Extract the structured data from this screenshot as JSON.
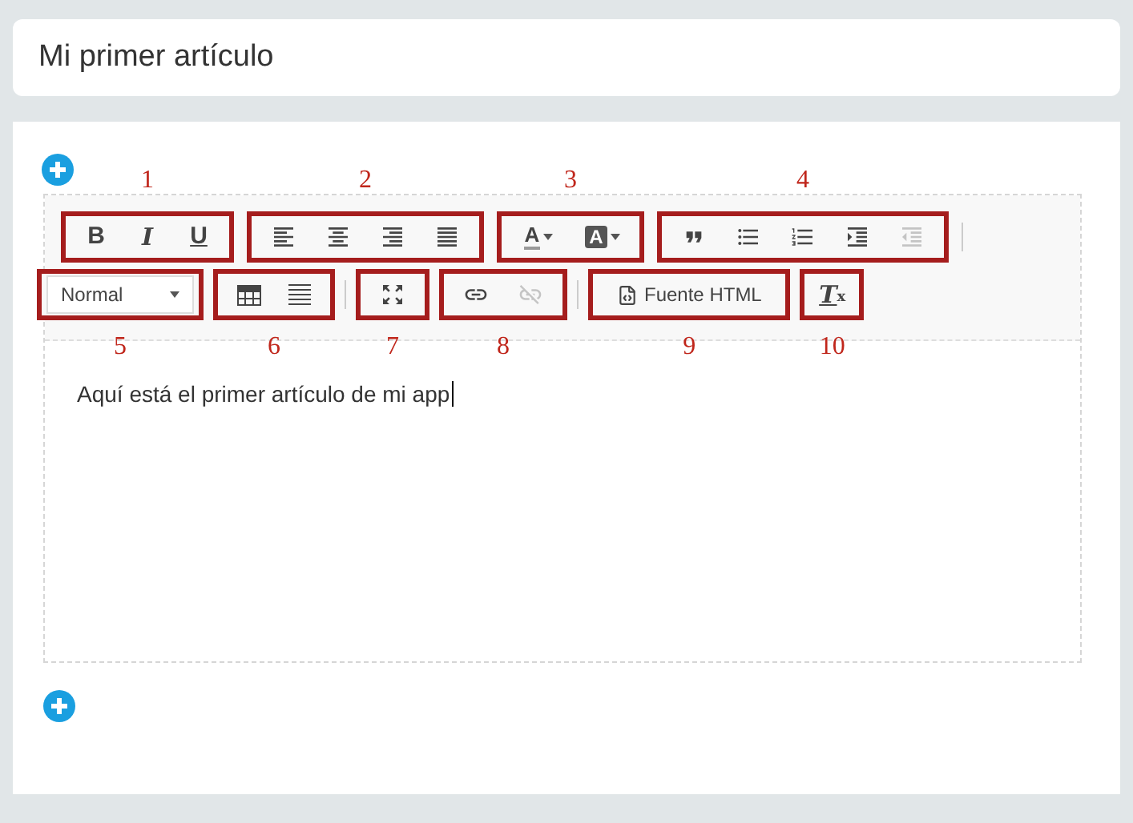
{
  "title": "Mi primer artículo",
  "editor": {
    "toolbar_rows": [
      [
        {
          "annotation": "1",
          "buttons": [
            {
              "kind": "bold",
              "label": "B",
              "disabled": false
            },
            {
              "kind": "italic",
              "label": "I",
              "disabled": false
            },
            {
              "kind": "underline",
              "label": "U",
              "disabled": false
            }
          ]
        },
        {
          "annotation": "2",
          "buttons": [
            {
              "kind": "align-left",
              "disabled": false
            },
            {
              "kind": "align-center",
              "disabled": false
            },
            {
              "kind": "align-right",
              "disabled": false
            },
            {
              "kind": "align-justify",
              "disabled": false
            }
          ]
        },
        {
          "annotation": "3",
          "buttons": [
            {
              "kind": "text-color",
              "label": "A",
              "disabled": false
            },
            {
              "kind": "background-color",
              "label": "A",
              "disabled": false
            }
          ]
        },
        {
          "annotation": "4",
          "buttons": [
            {
              "kind": "quote",
              "disabled": false
            },
            {
              "kind": "bulleted-list",
              "disabled": false
            },
            {
              "kind": "numbered-list",
              "disabled": false
            },
            {
              "kind": "indent",
              "disabled": false
            },
            {
              "kind": "outdent",
              "disabled": true
            }
          ]
        }
      ],
      [
        {
          "annotation": "5",
          "buttons": [
            {
              "kind": "select",
              "value": "Normal",
              "disabled": false
            }
          ]
        },
        {
          "annotation": "6",
          "buttons": [
            {
              "kind": "table",
              "disabled": false
            },
            {
              "kind": "horizontal-rule",
              "disabled": false
            }
          ]
        },
        {
          "annotation": "7",
          "buttons": [
            {
              "kind": "maximize",
              "disabled": false
            }
          ]
        },
        {
          "annotation": "8",
          "buttons": [
            {
              "kind": "link",
              "disabled": false
            },
            {
              "kind": "unlink",
              "disabled": true
            }
          ]
        },
        {
          "annotation": "9",
          "buttons": [
            {
              "kind": "source",
              "label": "Fuente HTML",
              "disabled": false
            }
          ]
        },
        {
          "annotation": "10",
          "buttons": [
            {
              "kind": "clear-format",
              "label": "T",
              "sub": "x",
              "disabled": false
            }
          ]
        }
      ]
    ],
    "content": "Aquí está el primer artículo de mi app"
  }
}
